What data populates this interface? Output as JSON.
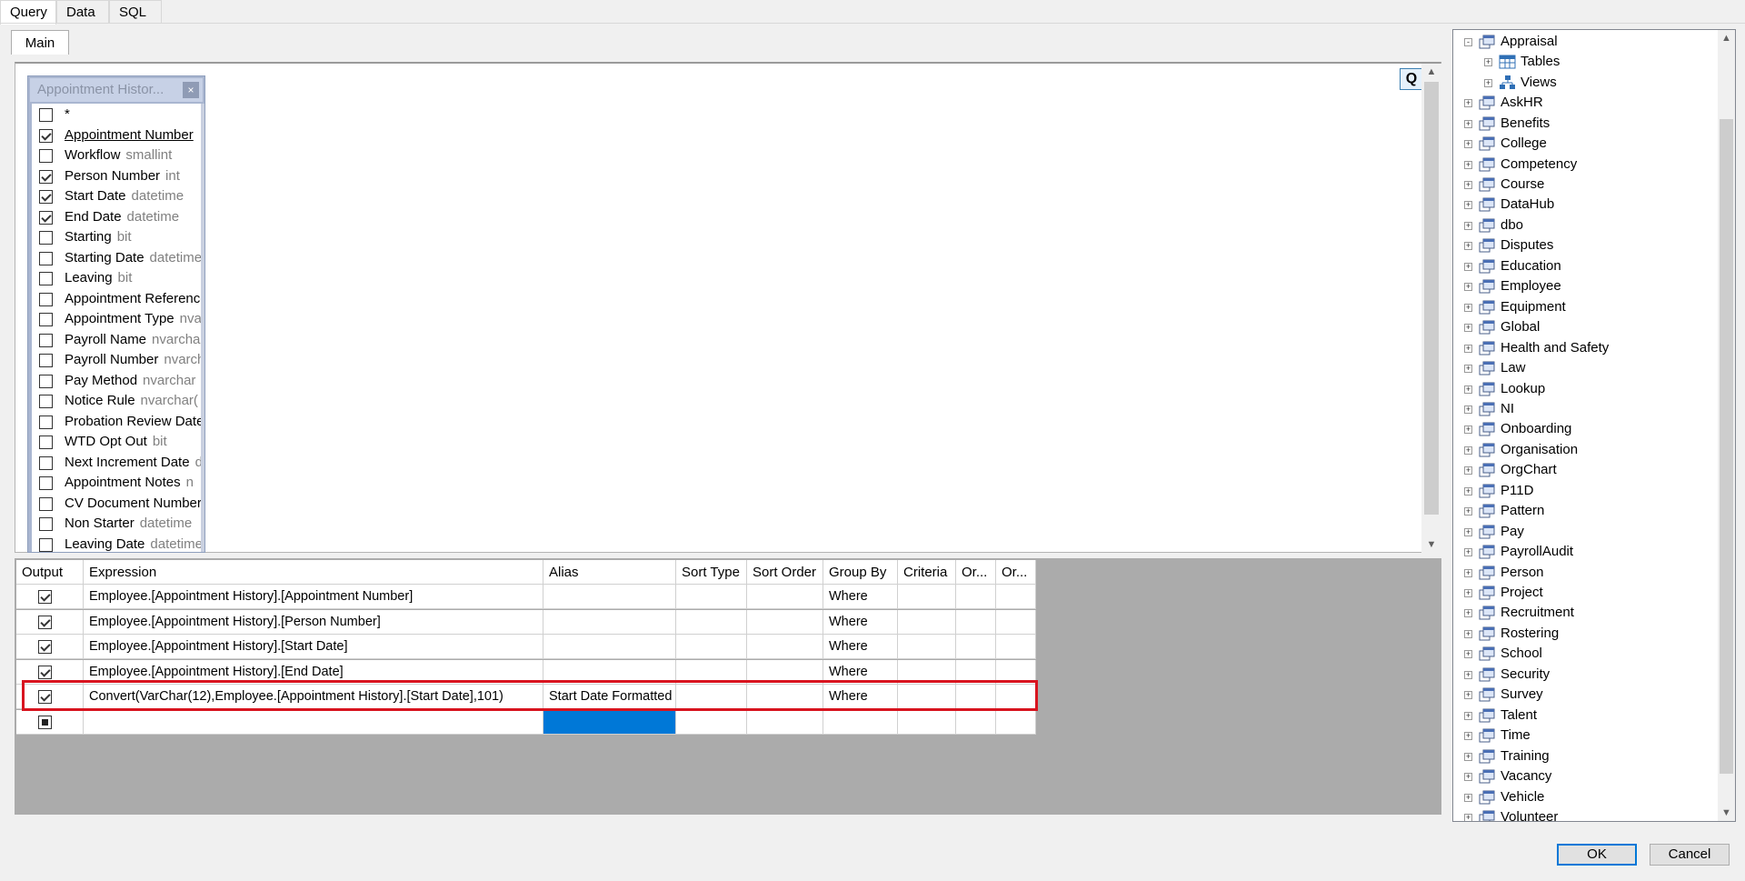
{
  "top_tabs": [
    "Query",
    "Data",
    "SQL"
  ],
  "main_tab": "Main",
  "diagram": {
    "q_button": "Q",
    "table_window": {
      "title": "Appointment Histor...",
      "close_glyph": "×",
      "columns": [
        {
          "name": "*",
          "type": "",
          "checked": false
        },
        {
          "name": "Appointment Number",
          "type": "",
          "checked": true,
          "underline": true
        },
        {
          "name": "Workflow",
          "type": "smallint",
          "checked": false
        },
        {
          "name": "Person Number",
          "type": "int",
          "checked": true
        },
        {
          "name": "Start Date",
          "type": "datetime",
          "checked": true
        },
        {
          "name": "End Date",
          "type": "datetime",
          "checked": true
        },
        {
          "name": "Starting",
          "type": "bit",
          "checked": false
        },
        {
          "name": "Starting Date",
          "type": "datetime",
          "checked": false
        },
        {
          "name": "Leaving",
          "type": "bit",
          "checked": false
        },
        {
          "name": "Appointment Reference",
          "type": "",
          "checked": false
        },
        {
          "name": "Appointment Type",
          "type": "nvarchar",
          "checked": false
        },
        {
          "name": "Payroll Name",
          "type": "nvarchar",
          "checked": false
        },
        {
          "name": "Payroll Number",
          "type": "nvarchar",
          "checked": false
        },
        {
          "name": "Pay Method",
          "type": "nvarchar",
          "checked": false
        },
        {
          "name": "Notice Rule",
          "type": "nvarchar(",
          "checked": false
        },
        {
          "name": "Probation Review Date",
          "type": "",
          "checked": false
        },
        {
          "name": "WTD Opt Out",
          "type": "bit",
          "checked": false
        },
        {
          "name": "Next Increment Date",
          "type": "d",
          "checked": false
        },
        {
          "name": "Appointment Notes",
          "type": "n",
          "checked": false
        },
        {
          "name": "CV Document Number",
          "type": "",
          "checked": false
        },
        {
          "name": "Non Starter",
          "type": "datetime",
          "checked": false
        },
        {
          "name": "Leaving Date",
          "type": "datetime",
          "checked": false
        }
      ]
    }
  },
  "grid": {
    "headers": [
      "Output",
      "Expression",
      "Alias",
      "Sort Type",
      "Sort Order",
      "Group By",
      "Criteria",
      "Or...",
      "Or..."
    ],
    "rows": [
      {
        "output": "checked",
        "expression": "Employee.[Appointment History].[Appointment Number]",
        "alias": "",
        "sort_type": "",
        "sort_order": "",
        "group_by": "Where",
        "criteria": "",
        "or1": "",
        "or2": ""
      },
      {
        "output": "checked",
        "expression": "Employee.[Appointment History].[Person Number]",
        "alias": "",
        "sort_type": "",
        "sort_order": "",
        "group_by": "Where",
        "criteria": "",
        "or1": "",
        "or2": ""
      },
      {
        "output": "checked",
        "expression": "Employee.[Appointment History].[Start Date]",
        "alias": "",
        "sort_type": "",
        "sort_order": "",
        "group_by": "Where",
        "criteria": "",
        "or1": "",
        "or2": ""
      },
      {
        "output": "checked",
        "expression": "Employee.[Appointment History].[End Date]",
        "alias": "",
        "sort_type": "",
        "sort_order": "",
        "group_by": "Where",
        "criteria": "",
        "or1": "",
        "or2": ""
      },
      {
        "output": "checked",
        "expression": "Convert(VarChar(12),Employee.[Appointment History].[Start Date],101)",
        "alias": "Start Date Formatted",
        "sort_type": "",
        "sort_order": "",
        "group_by": "Where",
        "criteria": "",
        "or1": "",
        "or2": ""
      },
      {
        "output": "indeterminate",
        "expression": "",
        "alias": "",
        "sort_type": "",
        "sort_order": "",
        "group_by": "",
        "criteria": "",
        "or1": "",
        "or2": ""
      }
    ]
  },
  "tree": {
    "expanded": {
      "label": "Appraisal",
      "children": [
        "Tables",
        "Views"
      ]
    },
    "items": [
      "AskHR",
      "Benefits",
      "College",
      "Competency",
      "Course",
      "DataHub",
      "dbo",
      "Disputes",
      "Education",
      "Employee",
      "Equipment",
      "Global",
      "Health and Safety",
      "Law",
      "Lookup",
      "NI",
      "Onboarding",
      "Organisation",
      "OrgChart",
      "P11D",
      "Pattern",
      "Pay",
      "PayrollAudit",
      "Person",
      "Project",
      "Recruitment",
      "Rostering",
      "School",
      "Security",
      "Survey",
      "Talent",
      "Time",
      "Training",
      "Vacancy",
      "Vehicle",
      "Volunteer"
    ]
  },
  "buttons": {
    "ok": "OK",
    "cancel": "Cancel"
  },
  "colors": {
    "highlight": "#d8141f",
    "selection": "#0078d7"
  }
}
